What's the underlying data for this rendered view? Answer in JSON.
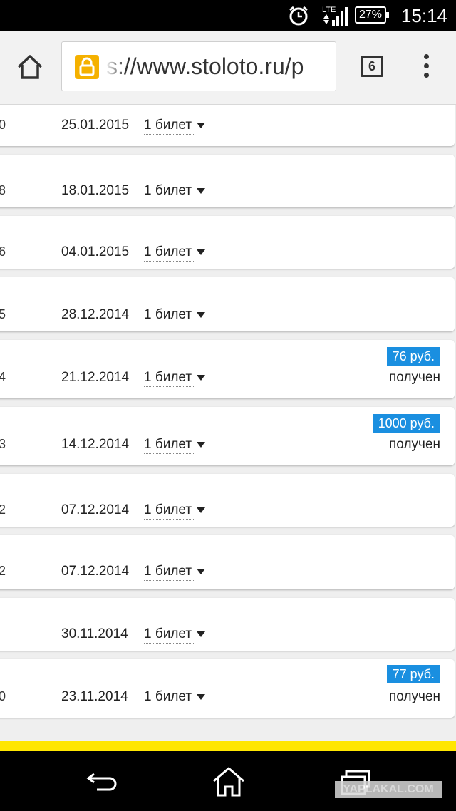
{
  "status_bar": {
    "time": "15:14",
    "battery": "27%",
    "network": "LTE"
  },
  "browser": {
    "url": "s://www.stoloto.ru/p",
    "tab_count": "6"
  },
  "rows": [
    {
      "cut": "0",
      "date": "25.01.2015",
      "ticket": "1 билет",
      "prize": "",
      "status": ""
    },
    {
      "cut": "8",
      "date": "18.01.2015",
      "ticket": "1 билет",
      "prize": "",
      "status": ""
    },
    {
      "cut": "6",
      "date": "04.01.2015",
      "ticket": "1 билет",
      "prize": "",
      "status": ""
    },
    {
      "cut": "5",
      "date": "28.12.2014",
      "ticket": "1 билет",
      "prize": "",
      "status": ""
    },
    {
      "cut": "4",
      "date": "21.12.2014",
      "ticket": "1 билет",
      "prize": "76 руб.",
      "status": "получен"
    },
    {
      "cut": "3",
      "date": "14.12.2014",
      "ticket": "1 билет",
      "prize": "1000 руб.",
      "status": "получен"
    },
    {
      "cut": "2",
      "date": "07.12.2014",
      "ticket": "1 билет",
      "prize": "",
      "status": ""
    },
    {
      "cut": "2",
      "date": "07.12.2014",
      "ticket": "1 билет",
      "prize": "",
      "status": ""
    },
    {
      "cut": "",
      "date": "30.11.2014",
      "ticket": "1 билет",
      "prize": "",
      "status": ""
    },
    {
      "cut": "0",
      "date": "23.11.2014",
      "ticket": "1 билет",
      "prize": "77 руб.",
      "status": "получен"
    }
  ],
  "watermark": "YAPLAKAL.COM",
  "colors": {
    "prize_badge": "#1a8fe0",
    "lock_icon": "#f5b100",
    "bottom_stripe": "#ffe600"
  }
}
